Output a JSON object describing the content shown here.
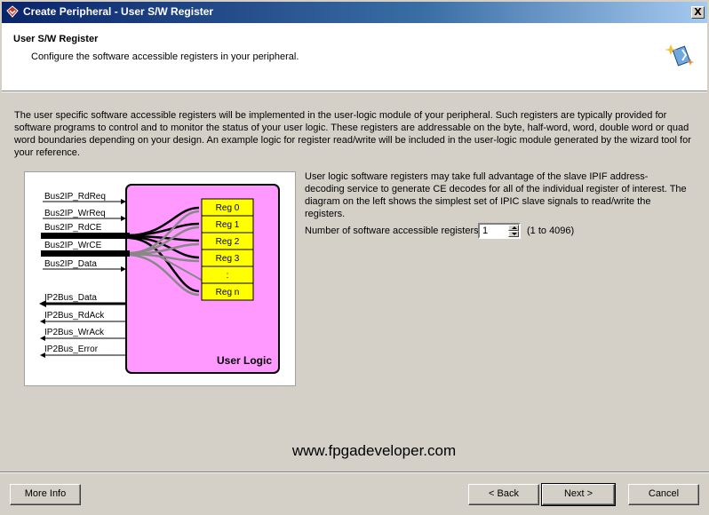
{
  "window": {
    "title": "Create Peripheral - User S/W Register",
    "close_label": "X"
  },
  "header": {
    "title": "User S/W Register",
    "subtitle": "Configure the software accessible registers in your peripheral.",
    "icon": "wizard-icon"
  },
  "intro_text": "The user specific software accessible registers will be implemented in the user-logic module of your peripheral. Such registers are typically provided for software programs to control and to monitor the status of your user logic. These registers are addressable on the byte, half-word, word, double word or quad word boundaries depending on your design. An example logic for register read/write will be included in the user-logic module generated by the wizard tool for your reference.",
  "diagram": {
    "inputs": [
      "Bus2IP_RdReq",
      "Bus2IP_WrReq",
      "Bus2IP_RdCE",
      "Bus2IP_WrCE",
      "Bus2IP_Data"
    ],
    "outputs": [
      "IP2Bus_Data",
      "IP2Bus_RdAck",
      "IP2Bus_WrAck",
      "IP2Bus_Error"
    ],
    "registers": [
      "Reg 0",
      "Reg 1",
      "Reg 2",
      "Reg 3",
      ":",
      "Reg n"
    ],
    "block_label": "User Logic",
    "colors": {
      "block": "#ff99ff",
      "register": "#ffff00"
    }
  },
  "description": "User logic software registers may take full advantage of the slave IPIF address-decoding service to generate CE decodes for all of the individual register of interest. The diagram on the left shows the simplest set of IPIC slave signals to read/write the registers.",
  "register_count": {
    "label": "Number of software accessible registers:",
    "value": "1",
    "range": "(1 to 4096)"
  },
  "watermark": "www.fpgadeveloper.com",
  "buttons": {
    "more_info": "More Info",
    "back": "< Back",
    "next": "Next >",
    "cancel": "Cancel"
  }
}
